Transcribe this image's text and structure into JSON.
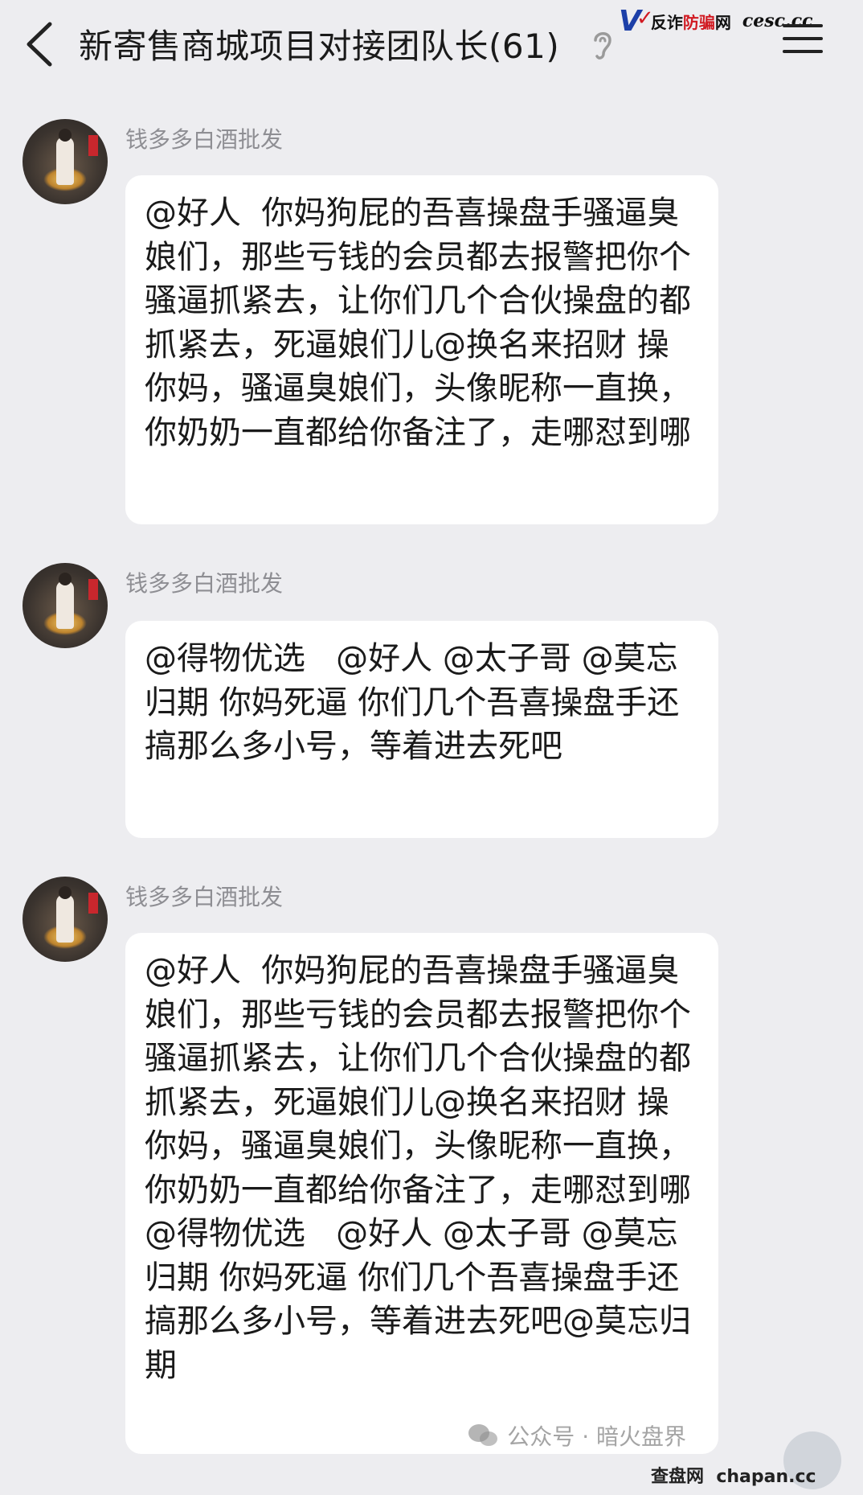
{
  "header": {
    "title": "新寄售商城项目对接团队长(61)",
    "brand_mark": "V",
    "brand_text_a": "反诈",
    "brand_text_b": "防骗",
    "brand_text_c": "网",
    "brand_domain": "cesc.cc"
  },
  "messages": [
    {
      "sender": "钱多多白酒批发",
      "text": "@好人  你妈狗屁的吾喜操盘手骚逼臭娘们，那些亏钱的会员都去报警把你个骚逼抓紧去，让你们几个合伙操盘的都抓紧去，死逼娘们儿@换名来招财 操你妈，骚逼臭娘们，头像昵称一直换，你奶奶一直都给你备注了，走哪怼到哪"
    },
    {
      "sender": "钱多多白酒批发",
      "text": "@得物优选   @好人 @太子哥 @莫忘归期 你妈死逼 你们几个吾喜操盘手还搞那么多小号，等着进去死吧"
    },
    {
      "sender": "钱多多白酒批发",
      "text": "@好人  你妈狗屁的吾喜操盘手骚逼臭娘们，那些亏钱的会员都去报警把你个骚逼抓紧去，让你们几个合伙操盘的都抓紧去，死逼娘们儿@换名来招财 操你妈，骚逼臭娘们，头像昵称一直换，你奶奶一直都给你备注了，走哪怼到哪@得物优选   @好人 @太子哥 @莫忘归期 你妈死逼 你们几个吾喜操盘手还搞那么多小号，等着进去死吧@莫忘归期"
    }
  ],
  "watermark": {
    "text": "公众号 · 暗火盘界",
    "site_a": "查盘网",
    "site_b": "chapan.cc"
  }
}
